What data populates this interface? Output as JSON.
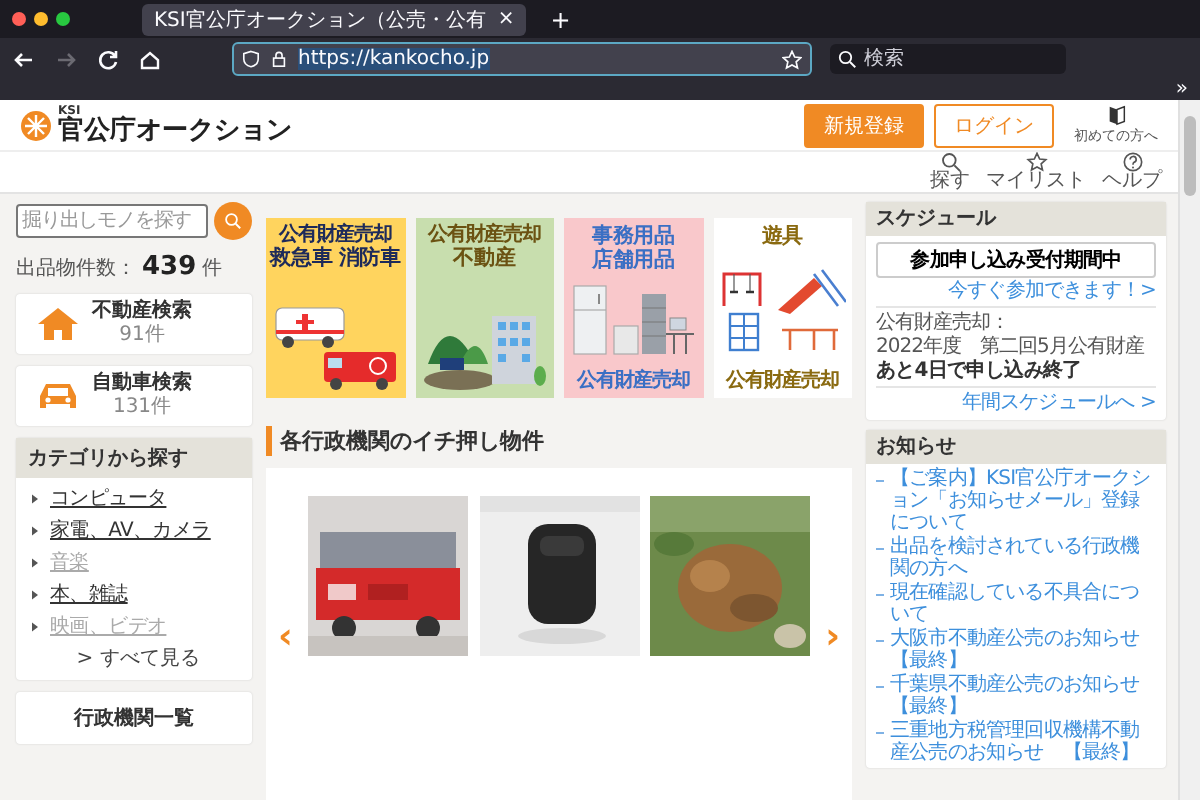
{
  "browser": {
    "tab": {
      "title": "KSI官公庁オークション（公売・公有",
      "close": "×"
    },
    "new_tab": "+",
    "nav_buttons": [
      {
        "kind": "back",
        "disabled": false
      },
      {
        "kind": "forward",
        "disabled": true
      },
      {
        "kind": "reload",
        "disabled": false
      },
      {
        "kind": "home",
        "disabled": false
      }
    ],
    "address": {
      "value": "https://kankocho.jp",
      "selected": true
    },
    "search": {
      "placeholder": "検索"
    },
    "overflow": "»"
  },
  "header": {
    "logo_small": "KSI",
    "logo": "官公庁オークション",
    "buttons": [
      {
        "label": "新規登録",
        "kind": "primary"
      },
      {
        "label": "ログイン",
        "kind": "outline"
      }
    ],
    "guide": "初めての方へ"
  },
  "nav": [
    {
      "label": "探す",
      "kind": "search"
    },
    {
      "label": "マイリスト",
      "kind": "star"
    },
    {
      "label": "ヘルプ",
      "kind": "help"
    }
  ],
  "sidebar": {
    "search": {
      "placeholder": "掘り出しモノを探す"
    },
    "count_label": "出品物件数：",
    "count": "439",
    "count_unit": "件",
    "quick": [
      {
        "kind": "house",
        "title": "不動産検索",
        "count": "91件"
      },
      {
        "kind": "car",
        "title": "自動車検索",
        "count": "131件"
      }
    ],
    "categories": {
      "title": "カテゴリから探す",
      "items": [
        {
          "label": "コンピュータ",
          "disabled": false
        },
        {
          "label": "家電、AV、カメラ",
          "disabled": false
        },
        {
          "label": "音楽",
          "disabled": true
        },
        {
          "label": "本、雑誌",
          "disabled": false
        },
        {
          "label": "映画、ビデオ",
          "disabled": true
        }
      ],
      "more": "> すべて見る"
    },
    "agencies": "行政機関一覧"
  },
  "banners": [
    {
      "kind": "vehicles",
      "top": [
        {
          "text": "公有財産売却",
          "large": false
        },
        {
          "text": "救急車 消防車",
          "large": true
        }
      ]
    },
    {
      "kind": "realestate",
      "top": [
        {
          "text": "公有財産売却",
          "large": false
        },
        {
          "text": "不動産",
          "large": true
        }
      ]
    },
    {
      "kind": "office",
      "top": [
        {
          "text": "事務用品",
          "large": true
        },
        {
          "text": "店舗用品",
          "large": true
        }
      ],
      "bottom": [
        {
          "text": "公有財産売却",
          "large": false
        }
      ]
    },
    {
      "kind": "playground",
      "top": [
        {
          "text": "遊具",
          "large": true
        }
      ],
      "bottom": [
        {
          "text": "公有財産売却",
          "large": false
        }
      ]
    }
  ],
  "featured": {
    "title": "各行政機関のイチ押し物件",
    "prev": "‹",
    "next": "›"
  },
  "schedule": {
    "title": "スケジュール",
    "button": "参加申し込み受付期間中",
    "link": "今すぐ参加できます！>",
    "note": [
      "公有財産売却：",
      "2022年度　第二回5月公有財産"
    ],
    "deadline": "あと4日で申し込み終了",
    "more": "年間スケジュールへ >"
  },
  "notices": {
    "title": "お知らせ",
    "items": [
      "【ご案内】KSI官公庁オークション「お知らせメール」登録について",
      "出品を検討されている行政機関の方へ",
      "現在確認している不具合について",
      "大阪市不動産公売のお知らせ【最終】",
      "千葉県不動産公売のお知らせ【最終】",
      "三重地方税管理回収機構不動産公売のお知らせ　【最終】"
    ]
  }
}
